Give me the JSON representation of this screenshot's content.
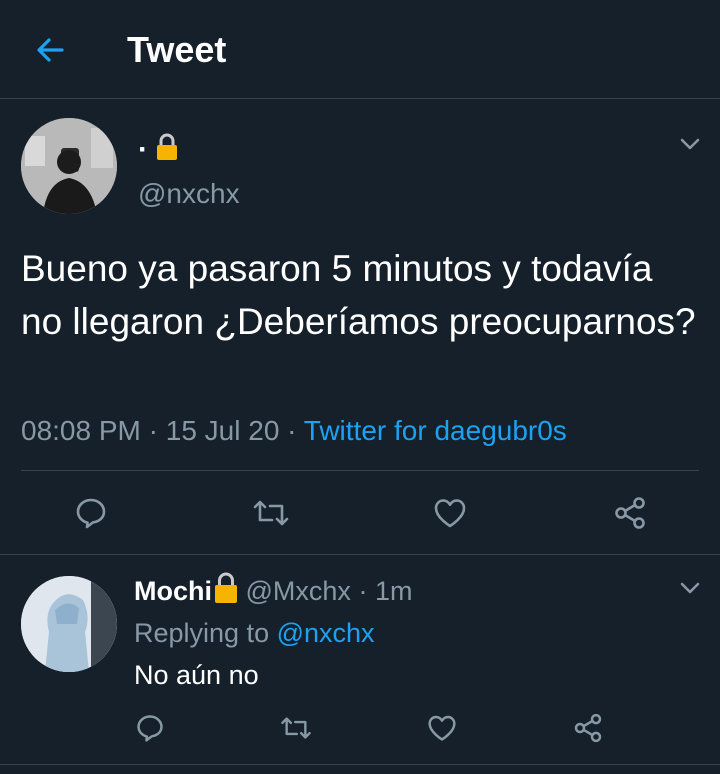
{
  "header": {
    "title": "Tweet",
    "back_icon": "arrow-left-icon"
  },
  "colors": {
    "background": "#15202b",
    "accent": "#1da1f2",
    "muted": "#8899a6",
    "divider": "#38444d",
    "lock": "#f5b400"
  },
  "tweet": {
    "author_name": "·",
    "author_handle": "@nxchx",
    "text": "Bueno ya pasaron 5 minutos y todavía no llegaron ¿Deberíamos preocuparnos?",
    "time": "08:08 PM",
    "date": "15 Jul 20",
    "separator": "·",
    "source": "Twitter for daegubr0s"
  },
  "reply": {
    "author_name": "Mochi",
    "author_handle": "@Mxchx",
    "separator": "·",
    "time": "1m",
    "replying_to_label": "Replying to",
    "replying_to_handle": "@nxchx",
    "text": "No aún no"
  },
  "actions": [
    "reply-icon",
    "retweet-icon",
    "like-icon",
    "share-icon"
  ]
}
